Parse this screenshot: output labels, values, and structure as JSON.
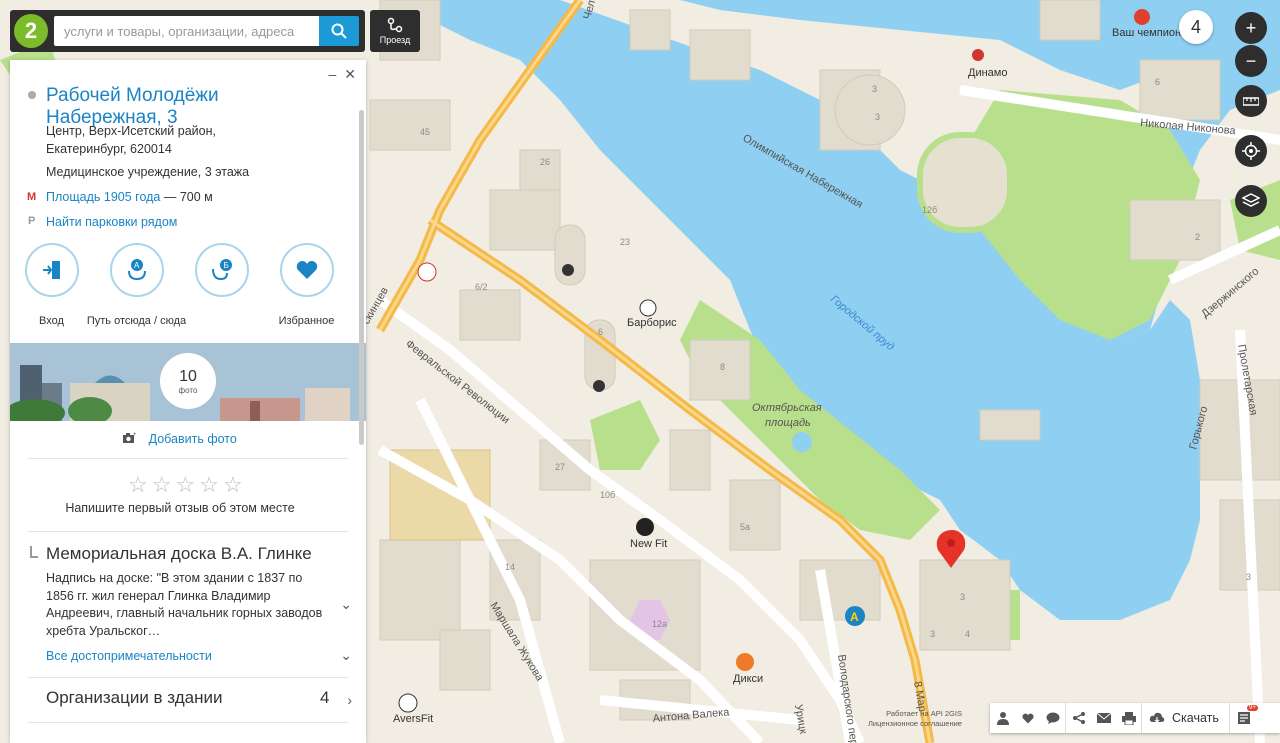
{
  "search": {
    "placeholder": "услуги и товары, организации, адреса"
  },
  "route_button": {
    "label": "Проезд"
  },
  "panel": {
    "title": "Рабочей Молодёжи Набережная, 3",
    "address_line1": "Центр, Верх-Исетский район,",
    "address_line2": "Екатеринбург, 620014",
    "type": "Медицинское учреждение, 3 этажа",
    "metro_station": "Площадь 1905 года",
    "metro_distance": "— 700 м",
    "parking_link": "Найти парковки рядом",
    "actions": [
      {
        "label": "Вход",
        "icon": "entrance-icon"
      },
      {
        "label": "Путь отсюда / сюда",
        "icon": "route-ab-icon"
      },
      {
        "label": "Избранное",
        "icon": "heart-icon"
      }
    ],
    "photos": {
      "count": "10",
      "label": "фото"
    },
    "add_photo": "Добавить фото",
    "review_hint": "Напишите первый отзыв об этом месте",
    "monument": {
      "title": "Мемориальная доска В.А. Глинке",
      "text": "Надпись на доске: \"В этом здании с 1837 по 1856 гг. жил генерал Глинка Владимир Андреевич, главный начальник горных заводов хребта Уральског…"
    },
    "all_sights": "Все достопримечательности",
    "orgs": {
      "label": "Организации в здании",
      "count": "4"
    }
  },
  "map": {
    "zoom_level": "4",
    "labels": {
      "olympic": "Олимпийская Набережная",
      "pond": "Городской пруд",
      "february": "Февральской Революции",
      "oct_square_1": "Октябрьская",
      "oct_square_2": "площадь",
      "barboris": "Барборис",
      "newfit": "New Fit",
      "dixi": "Дикси",
      "aversfit": "AversFit",
      "zhukova": "Маршала Жукова",
      "valeka": "Антона Валека",
      "volodarskogo": "Володарского пер",
      "dzerzhinskogo": "Дзержинского",
      "proletarskaya": "Пролетарская",
      "gorkogo": "Горького",
      "nikonova": "Николая Никонова",
      "dinamo": "Динамо",
      "champion": "Ваш чемпион",
      "march8": "8 Мар",
      "urits": "Урицк",
      "karlib_fragment": "скинцев",
      "chel_fragment": "Чел"
    }
  },
  "bottom": {
    "download": "Скачать",
    "api_line1": "Работает на API 2GIS",
    "api_line2": "Лицензионное соглашение",
    "badge": "9+"
  },
  "colors": {
    "accent": "#1a84c4",
    "water": "#8fcff1",
    "park": "#b8df8c",
    "road": "#f5b94a",
    "pin": "#e5332a"
  }
}
